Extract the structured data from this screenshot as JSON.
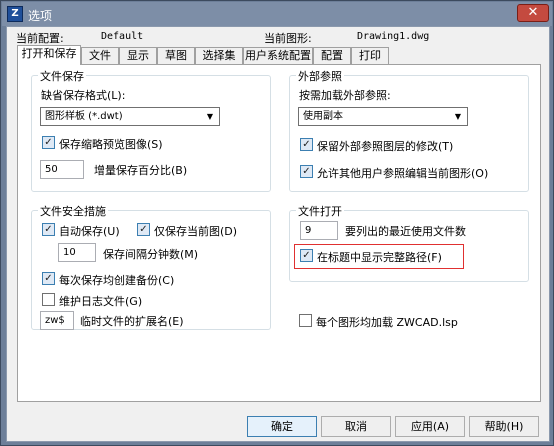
{
  "window": {
    "title": "选项",
    "close_glyph": "✕",
    "icon": "app-icon"
  },
  "header": {
    "current_config_label": "当前配置:",
    "current_config_value": "Default",
    "current_drawing_label": "当前图形:",
    "current_drawing_value": "Drawing1.dwg"
  },
  "tabs": [
    {
      "label": "打开和保存",
      "active": true
    },
    {
      "label": "文件"
    },
    {
      "label": "显示"
    },
    {
      "label": "草图"
    },
    {
      "label": "选择集"
    },
    {
      "label": "用户系统配置"
    },
    {
      "label": "配置"
    },
    {
      "label": "打印"
    }
  ],
  "file_save": {
    "title": "文件保存",
    "default_format_label": "缺省保存格式(L):",
    "format_value": "图形样板 (*.dwt)",
    "save_thumbnail": {
      "label": "保存缩略预览图像(S)",
      "checked": true
    },
    "incremental_value": "50",
    "incremental_label": "增量保存百分比(B)"
  },
  "xref": {
    "title": "外部参照",
    "demand_load_label": "按需加载外部参照:",
    "demand_load_value": "使用副本",
    "retain_changes": {
      "label": "保留外部参照图层的修改(T)",
      "checked": true
    },
    "allow_edit": {
      "label": "允许其他用户参照编辑当前图形(O)",
      "checked": true
    }
  },
  "file_safety": {
    "title": "文件安全措施",
    "auto_save": {
      "label": "自动保存(U)",
      "checked": true
    },
    "save_current_only": {
      "label": "仅保存当前图(D)",
      "checked": true
    },
    "interval_value": "10",
    "interval_label": "保存间隔分钟数(M)",
    "create_backup": {
      "label": "每次保存均创建备份(C)",
      "checked": true
    },
    "maintain_log": {
      "label": "维护日志文件(G)",
      "checked": false
    },
    "temp_ext_value": "zw$",
    "temp_ext_label": "临时文件的扩展名(E)"
  },
  "file_open": {
    "title": "文件打开",
    "recent_count_value": "9",
    "recent_count_label": "要列出的最近使用文件数",
    "show_full_path": {
      "label": "在标题中显示完整路径(F)",
      "checked": true
    },
    "highlight_color": "#e03030"
  },
  "load_lsp": {
    "label": "每个图形均加载 ZWCAD.lsp",
    "checked": false
  },
  "buttons": {
    "ok": "确定",
    "cancel": "取消",
    "apply": "应用(A)",
    "help": "帮助(H)"
  },
  "check_glyph": "✓",
  "colors": {
    "titlebar": "#7d8ea7",
    "accent": "#3c7fb1"
  }
}
